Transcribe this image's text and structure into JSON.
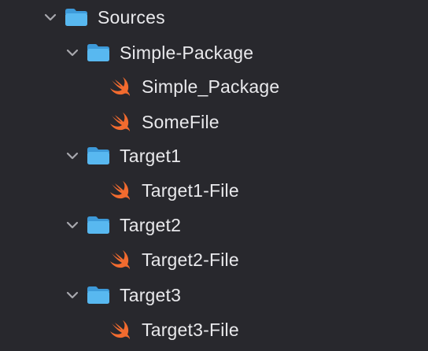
{
  "colors": {
    "background": "#28282d",
    "text": "#e9e9ec",
    "folder": "#58b8f0",
    "folder_tab": "#3d9ad9",
    "swift_orange": "#f26b2f",
    "chevron": "#a8a8ad"
  },
  "icons": {
    "disclosure": "chevron-down-icon",
    "folder": "folder-icon",
    "swift_file": "swift-file-icon"
  },
  "tree": {
    "sources": {
      "label": "Sources",
      "expanded": true,
      "children": {
        "simple_package": {
          "label": "Simple-Package",
          "expanded": true,
          "files": [
            "Simple_Package",
            "SomeFile"
          ]
        },
        "target1": {
          "label": "Target1",
          "expanded": true,
          "files": [
            "Target1-File"
          ]
        },
        "target2": {
          "label": "Target2",
          "expanded": true,
          "files": [
            "Target2-File"
          ]
        },
        "target3": {
          "label": "Target3",
          "expanded": true,
          "files": [
            "Target3-File"
          ]
        }
      }
    }
  }
}
